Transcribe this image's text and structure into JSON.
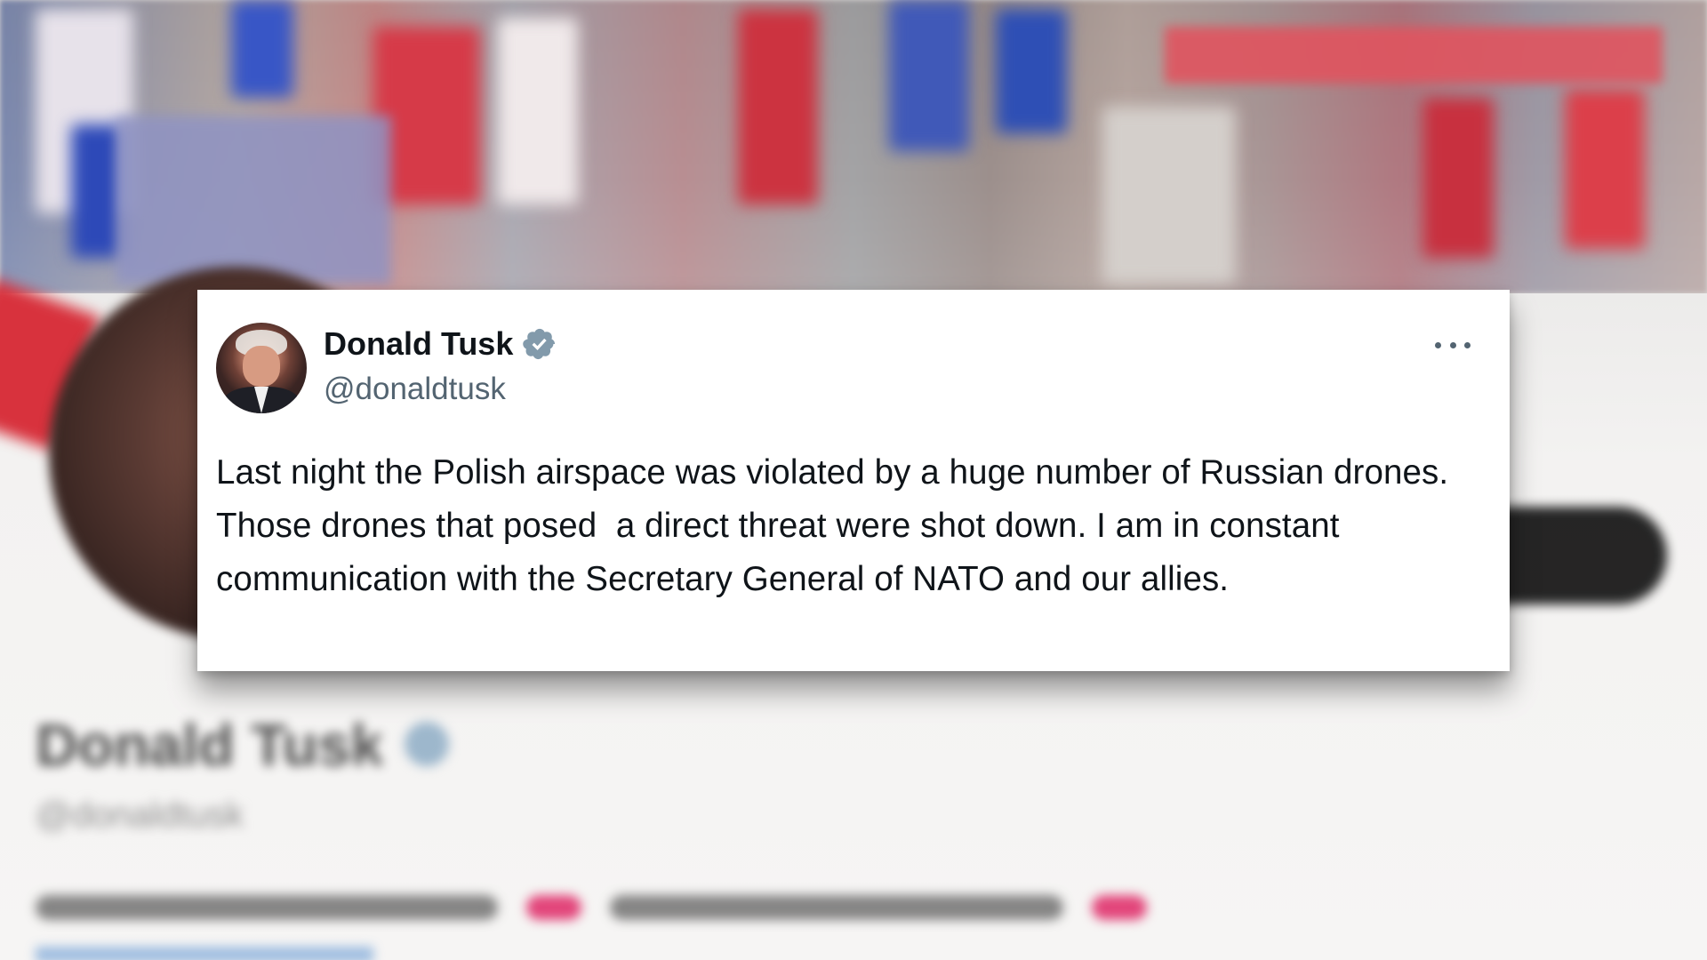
{
  "tweet": {
    "display_name": "Donald Tusk",
    "handle": "@donaldtusk",
    "text": "Last night the Polish airspace was violated by a huge number of Russian drones. Those drones that posed  a direct threat were shot down. I am in constant communication with the Secretary General of NATO and our allies.",
    "verified": true,
    "verified_icon": "verified-badge-icon",
    "more_icon": "more-options-icon",
    "avatar_icon": "profile-avatar"
  },
  "colors": {
    "card_background": "#ffffff",
    "name_text": "#0f1419",
    "handle_text": "#536471",
    "verified_badge": "#829aab"
  }
}
